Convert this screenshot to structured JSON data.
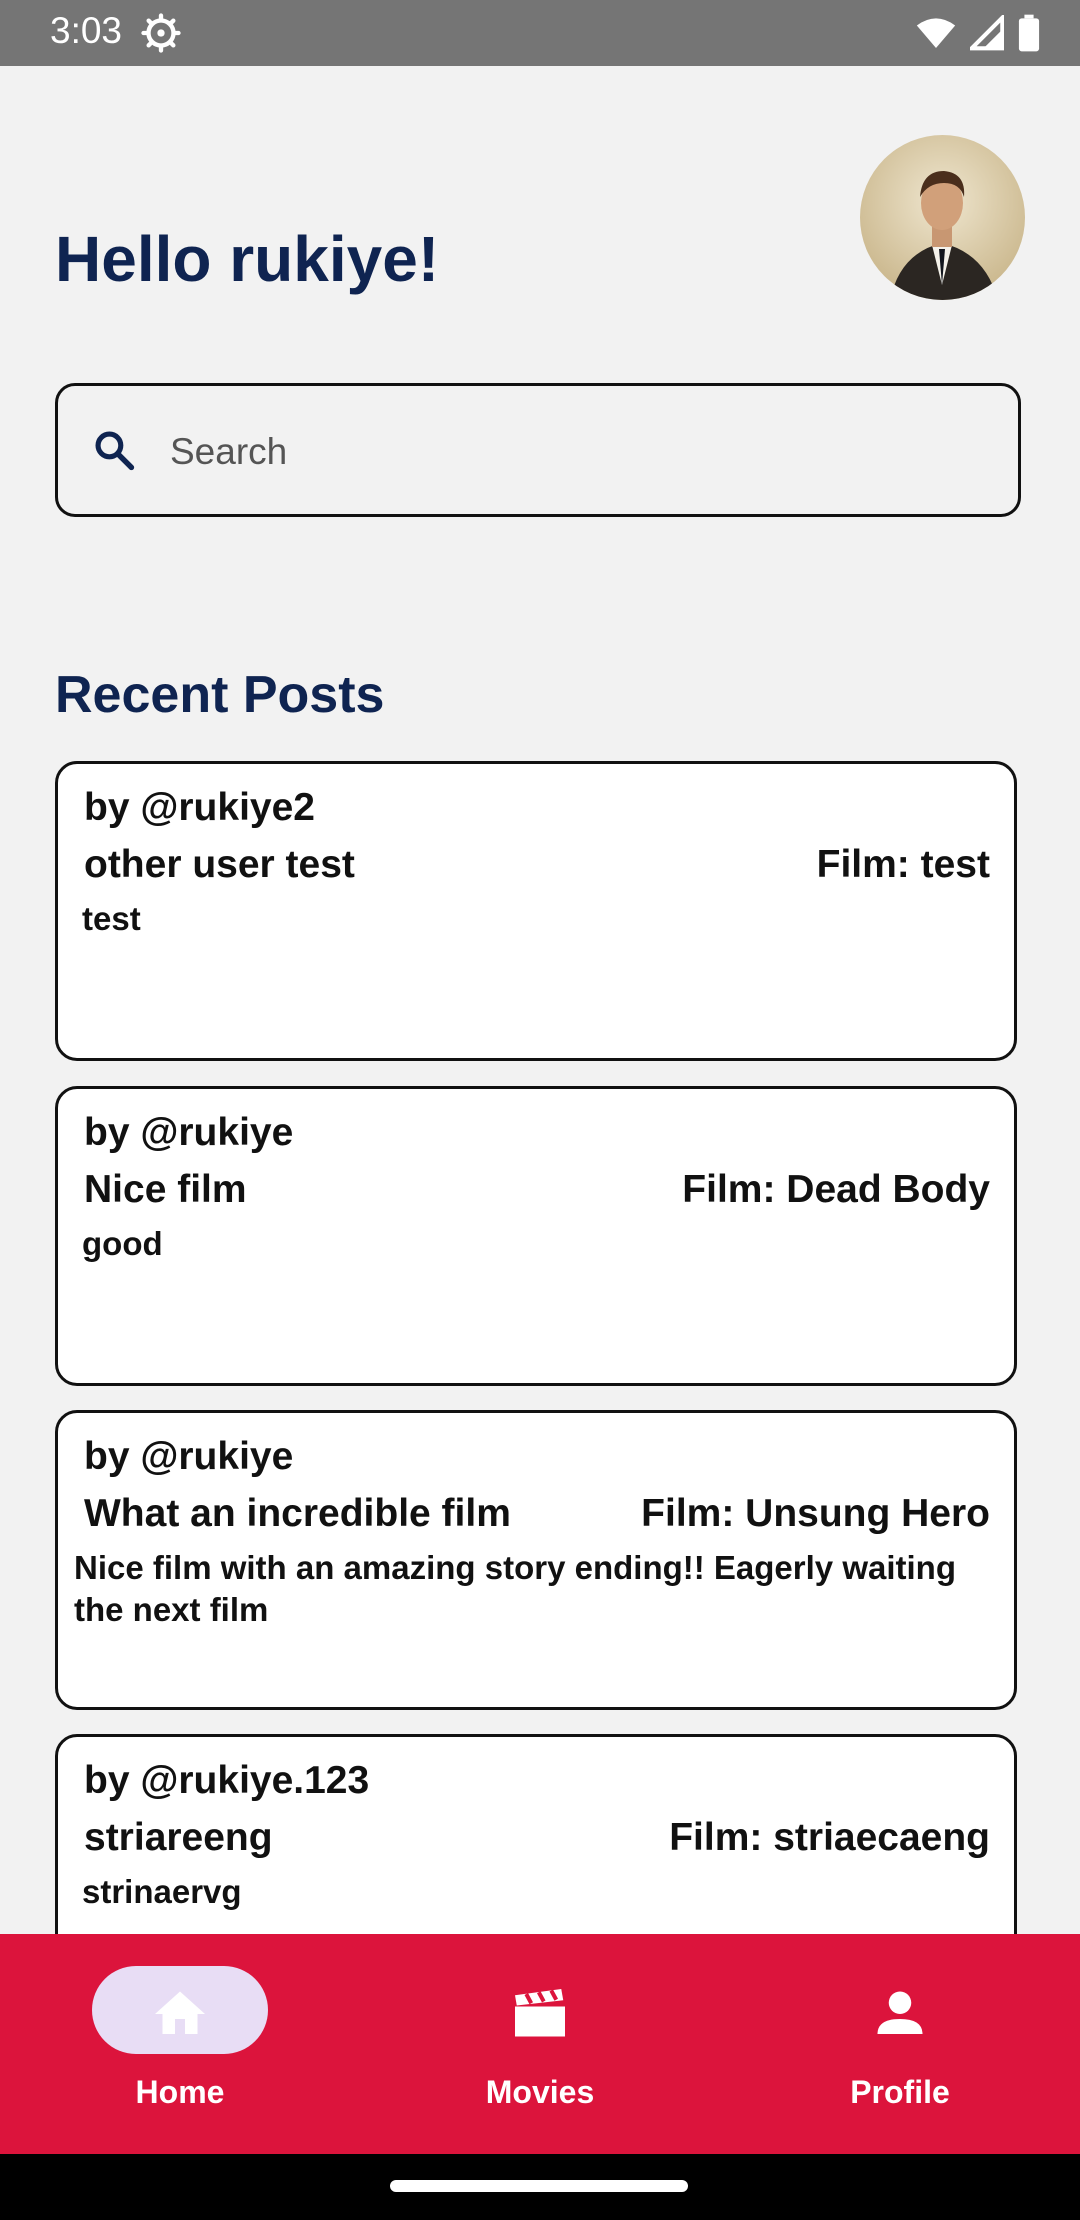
{
  "status_bar": {
    "time": "3:03",
    "icons": [
      "settings-gear-icon",
      "wifi-icon",
      "signal-icon",
      "battery-icon"
    ]
  },
  "header": {
    "greeting": "Hello rukiye!",
    "avatar_description": "profile photo of man in suit"
  },
  "search": {
    "placeholder": "Search",
    "value": ""
  },
  "recent_posts": {
    "title": "Recent Posts",
    "posts": [
      {
        "author": "by @rukiye2",
        "title": "other user test",
        "film": "Film: test",
        "body": "test"
      },
      {
        "author": "by @rukiye",
        "title": "Nice film",
        "film": "Film: Dead Body",
        "body": "good"
      },
      {
        "author": "by @rukiye",
        "title": "What an incredible film",
        "film": "Film: Unsung Hero",
        "body": "Nice film with an amazing story ending!! Eagerly waiting the next film"
      },
      {
        "author": "by @rukiye.123",
        "title": "striareeng",
        "film": "Film: striaecaeng",
        "body": "strinaervg"
      }
    ]
  },
  "bottom_nav": {
    "items": [
      {
        "label": "Home",
        "icon": "home-icon",
        "selected": true
      },
      {
        "label": "Movies",
        "icon": "clapperboard-icon",
        "selected": false
      },
      {
        "label": "Profile",
        "icon": "person-icon",
        "selected": false
      }
    ]
  },
  "colors": {
    "accent_navy": "#0f2451",
    "nav_red": "#dc143c",
    "nav_pill": "#e8ddf5"
  }
}
